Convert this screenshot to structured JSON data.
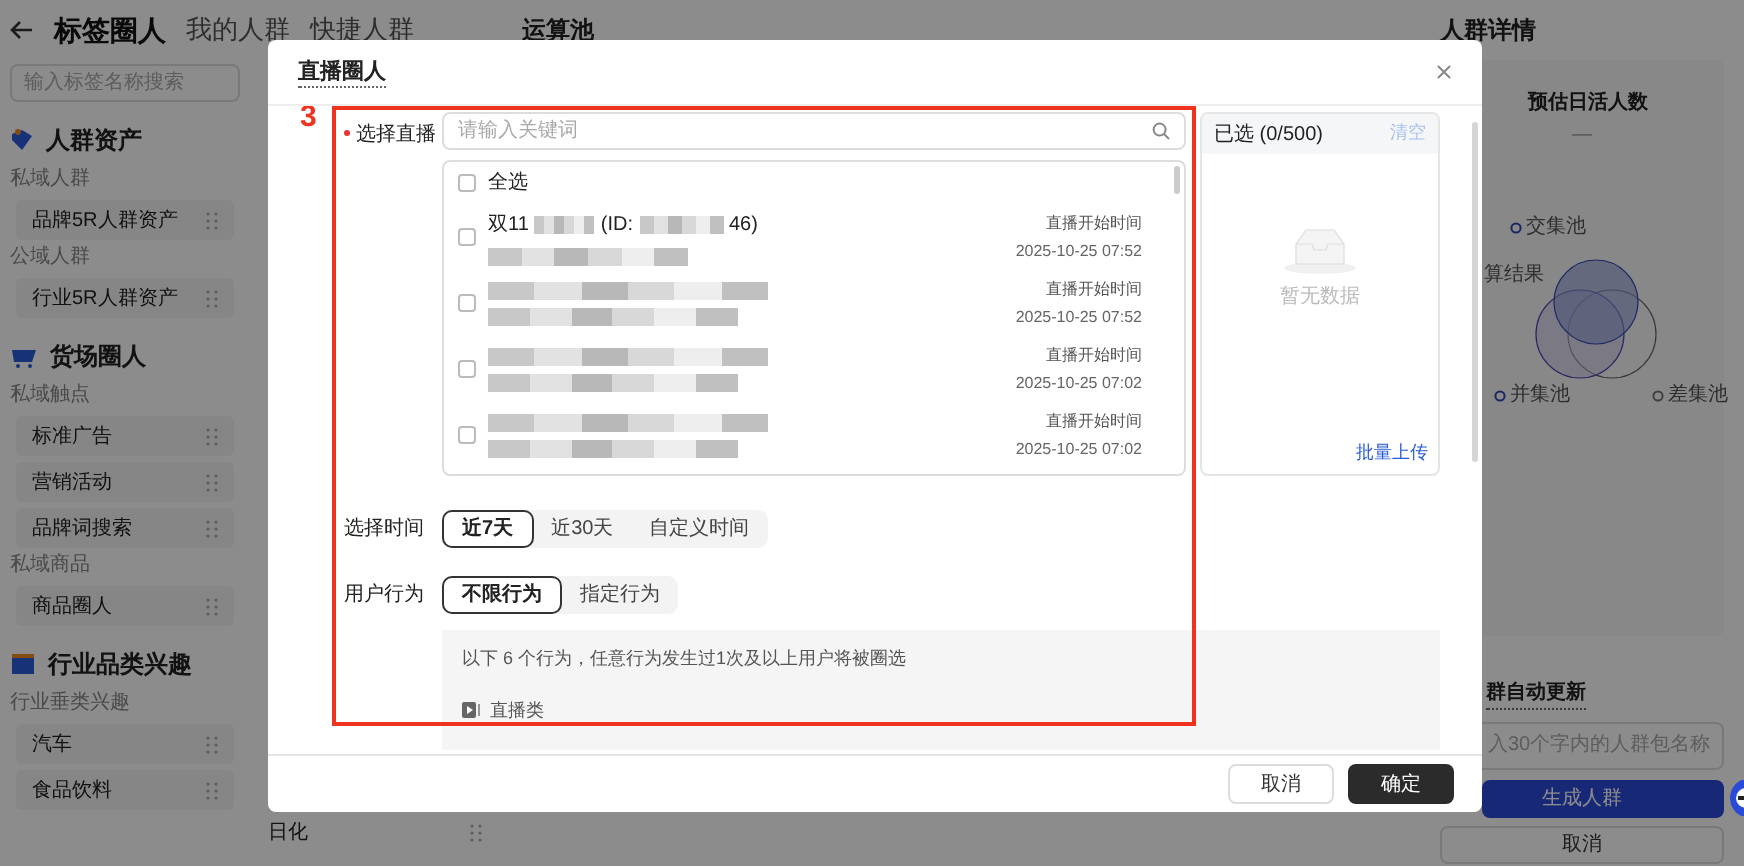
{
  "top_bar": {
    "tabs": [
      {
        "label": "标签圈人",
        "selected": true
      },
      {
        "label": "我的人群",
        "selected": false
      },
      {
        "label": "快捷人群",
        "selected": false
      }
    ]
  },
  "sidebar": {
    "search_placeholder": "输入标签名称搜索",
    "sections": [
      {
        "title": "人群资产",
        "kind": "assets",
        "groups": [
          {
            "title": "私域人群",
            "items": [
              "品牌5R人群资产"
            ]
          },
          {
            "title": "公域人群",
            "items": [
              "行业5R人群资产"
            ]
          }
        ]
      },
      {
        "title": "货场圈人",
        "kind": "cart",
        "groups": [
          {
            "title": "私域触点",
            "items": [
              "标准广告",
              "营销活动",
              "品牌词搜索"
            ]
          },
          {
            "title": "私域商品",
            "items": [
              "商品圈人"
            ]
          }
        ]
      },
      {
        "title": "行业品类兴趣",
        "kind": "flag",
        "groups": [
          {
            "title": "行业垂类兴趣",
            "items": [
              "汽车",
              "食品饮料"
            ]
          }
        ]
      }
    ]
  },
  "pool": {
    "title": "运算池",
    "items": [
      "日化"
    ]
  },
  "details": {
    "title": "人群详情",
    "estimate_label": "预估日活人数",
    "estimate_value": "—",
    "venn_labels": [
      {
        "label": "交集池",
        "kind": "intersection"
      },
      {
        "label": "算结果",
        "kind": "result"
      },
      {
        "label": "并集池",
        "kind": "union"
      },
      {
        "label": "差集池",
        "kind": "difference"
      }
    ],
    "auto_update_label": "群自动更新",
    "name_placeholder": "入30个字内的人群包名称",
    "buttons": [
      {
        "label": "生成人群",
        "kind": "primary"
      },
      {
        "label": "取消",
        "kind": "default"
      }
    ]
  },
  "modal": {
    "title": "直播圈人",
    "annotation": "3",
    "live_field": {
      "label": "选择直播",
      "required": true,
      "placeholder": "请输入关键词"
    },
    "select_all": {
      "label": "全选",
      "checked": false
    },
    "lives": [
      {
        "name_parts": [
          "双11",
          "(ID:",
          "46)"
        ],
        "start_label": "直播开始时间",
        "start_time": "2025-10-25 07:52",
        "checked": false
      },
      {
        "start_label": "直播开始时间",
        "start_time": "2025-10-25 07:52",
        "checked": false
      },
      {
        "start_label": "直播开始时间",
        "start_time": "2025-10-25 07:02",
        "checked": false
      },
      {
        "start_label": "直播开始时间",
        "start_time": "2025-10-25 07:02",
        "checked": false
      }
    ],
    "selected_panel": {
      "title": "已选 (0/500)",
      "clear": "清空",
      "empty_text": "暂无数据",
      "upload": "批量上传"
    },
    "time": {
      "label": "选择时间",
      "options": [
        {
          "label": "近7天",
          "selected": true
        },
        {
          "label": "近30天",
          "selected": false
        },
        {
          "label": "自定义时间",
          "selected": false
        }
      ]
    },
    "behavior": {
      "label": "用户行为",
      "options": [
        {
          "label": "不限行为",
          "selected": true
        },
        {
          "label": "指定行为",
          "selected": false
        }
      ],
      "note": "以下 6 个行为，任意行为发生过1次及以上用户将被圈选",
      "category": "直播类"
    },
    "buttons": [
      {
        "label": "取消",
        "kind": "default"
      },
      {
        "label": "确定",
        "kind": "primary"
      }
    ]
  }
}
